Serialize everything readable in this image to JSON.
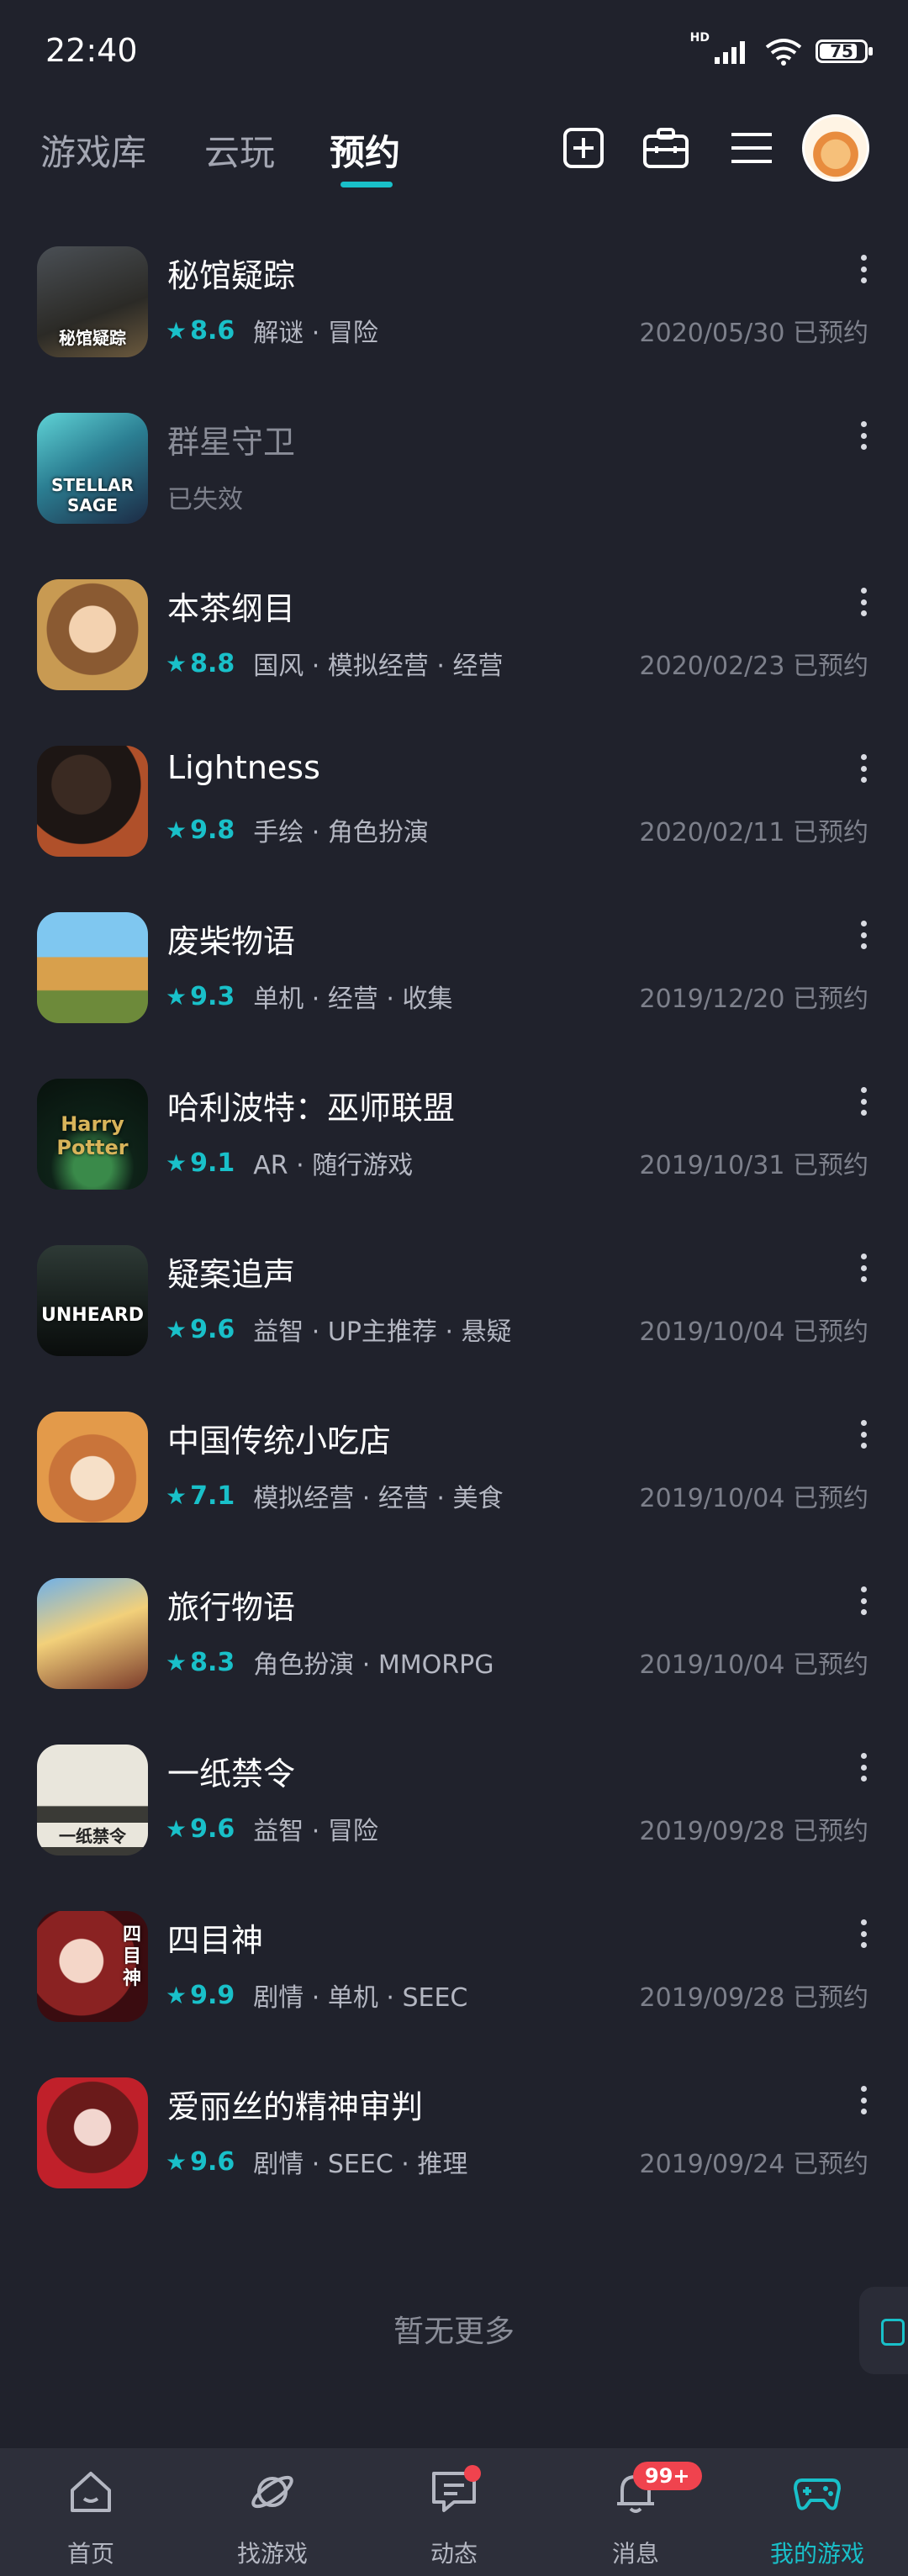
{
  "status": {
    "time": "22:40",
    "hd": "HD",
    "battery": "75"
  },
  "header": {
    "tabs": [
      {
        "label": "游戏库"
      },
      {
        "label": "云玩"
      },
      {
        "label": "预约"
      }
    ],
    "active_tab": "预约",
    "accent": "#19c0c9"
  },
  "games": [
    {
      "title": "秘馆疑踪",
      "score": "8.6",
      "tags": "解谜 · 冒险",
      "date": "2020/05/30 已预约",
      "thumb_text": "秘馆疑踪"
    },
    {
      "title": "群星守卫",
      "status": "已失效",
      "thumb_text": "STELLAR SAGE"
    },
    {
      "title": "本茶纲目",
      "score": "8.8",
      "tags": "国风 · 模拟经营 · 经营",
      "date": "2020/02/23 已预约"
    },
    {
      "title": "Lightness",
      "score": "9.8",
      "tags": "手绘 · 角色扮演",
      "date": "2020/02/11 已预约"
    },
    {
      "title": "废柴物语",
      "score": "9.3",
      "tags": "单机 · 经营 · 收集",
      "date": "2019/12/20 已预约"
    },
    {
      "title": "哈利波特：巫师联盟",
      "score": "9.1",
      "tags": "AR · 随行游戏",
      "date": "2019/10/31 已预约",
      "thumb_text": "Harry Potter"
    },
    {
      "title": "疑案追声",
      "score": "9.6",
      "tags": "益智 · UP主推荐 · 悬疑",
      "date": "2019/10/04 已预约",
      "thumb_text": "UNHEARD"
    },
    {
      "title": "中国传统小吃店",
      "score": "7.1",
      "tags": "模拟经营 · 经营 · 美食",
      "date": "2019/10/04 已预约"
    },
    {
      "title": "旅行物语",
      "score": "8.3",
      "tags": "角色扮演 · MMORPG",
      "date": "2019/10/04 已预约"
    },
    {
      "title": "一纸禁令",
      "score": "9.6",
      "tags": "益智 · 冒险",
      "date": "2019/09/28 已预约",
      "thumb_text": "一纸禁令"
    },
    {
      "title": "四目神",
      "score": "9.9",
      "tags": "剧情 · 单机 · SEEC",
      "date": "2019/09/28 已预约",
      "thumb_text": "四目神"
    },
    {
      "title": "爱丽丝的精神审判",
      "score": "9.6",
      "tags": "剧情 · SEEC · 推理",
      "date": "2019/09/24 已预约"
    }
  ],
  "footer_text": "暂无更多",
  "bottom_nav": [
    {
      "label": "首页",
      "icon": "home-icon"
    },
    {
      "label": "找游戏",
      "icon": "planet-icon"
    },
    {
      "label": "动态",
      "icon": "chat-icon"
    },
    {
      "label": "消息",
      "icon": "bell-icon",
      "badge": "99+"
    },
    {
      "label": "我的游戏",
      "icon": "gamepad-icon",
      "active": true
    }
  ]
}
